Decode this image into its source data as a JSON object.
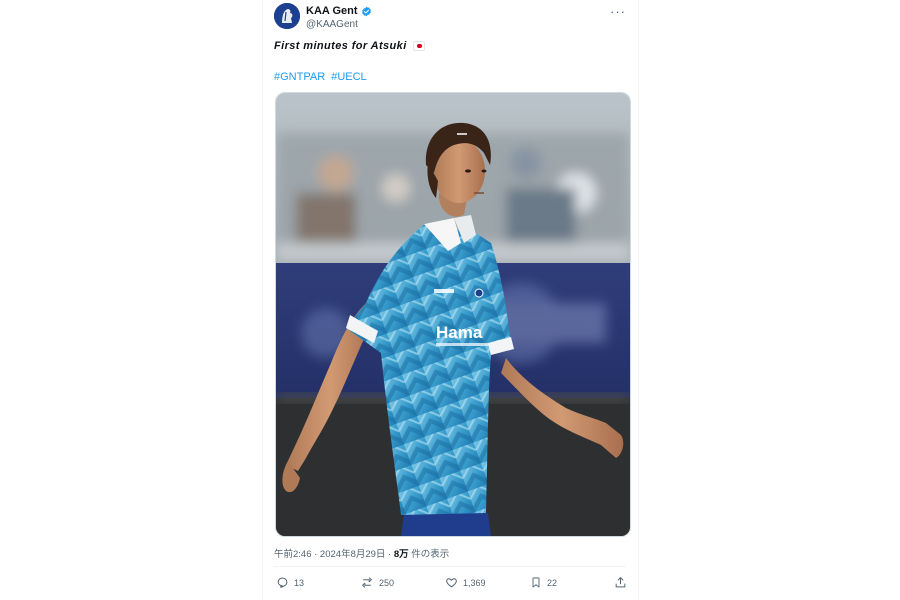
{
  "account": {
    "name": "KAA Gent",
    "handle": "@KAAGent",
    "avatar_icon": "kaa-gent-crest-icon",
    "verified_icon": "verified-badge-icon",
    "brand_color": "#1d3f8f"
  },
  "tweet": {
    "text": "First minutes for Atsuki",
    "emoji": "japan-flag",
    "hashtags": [
      "#GNTPAR",
      "#UECL"
    ],
    "media": {
      "jersey_sponsor": "Hama"
    }
  },
  "meta": {
    "time_date": "午前2:46 · 2024年8月29日 · ",
    "views_count": "8万",
    "views_label": " 件の表示"
  },
  "actions": {
    "replies": "13",
    "reposts": "250",
    "likes": "1,369",
    "bookmarks": "22"
  },
  "colors": {
    "link": "#1d9bf0",
    "secondary_text": "#536471",
    "primary_text": "#0f1419"
  }
}
